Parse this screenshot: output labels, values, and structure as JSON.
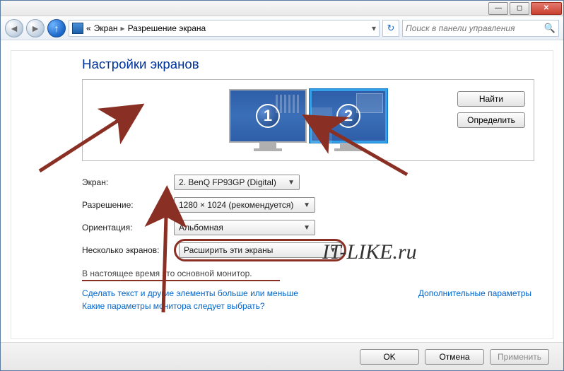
{
  "window_controls": {
    "minimize_glyph": "—",
    "maximize_glyph": "◻",
    "close_glyph": "✕"
  },
  "nav": {
    "back_glyph": "◄",
    "forward_glyph": "►",
    "up_glyph": "↑",
    "prefix": "«",
    "crumb1": "Экран",
    "sep": "▸",
    "crumb2": "Разрешение экрана",
    "drop_glyph": "▾",
    "refresh_glyph": "↻",
    "search_placeholder": "Поиск в панели управления",
    "search_icon": "🔍"
  },
  "heading": "Настройки экранов",
  "monitors": {
    "num1": "1",
    "num2": "2"
  },
  "buttons": {
    "find": "Найти",
    "detect": "Определить"
  },
  "form": {
    "screen_label": "Экран:",
    "screen_value": "2. BenQ FP93GP (Digital)",
    "resolution_label": "Разрешение:",
    "resolution_value": "1280 × 1024 (рекомендуется)",
    "orientation_label": "Ориентация:",
    "orientation_value": "Альбомная",
    "multi_label": "Несколько экранов:",
    "multi_value": "Расширить эти экраны",
    "arrow": "▼"
  },
  "note": "В настоящее время это основной монитор.",
  "links": {
    "advanced": "Дополнительные параметры",
    "bigger": "Сделать текст и другие элементы больше или меньше",
    "which": "Какие параметры монитора следует выбрать?"
  },
  "footer": {
    "ok": "OK",
    "cancel": "Отмена",
    "apply": "Применить"
  },
  "watermark": "IT-LIKE.ru",
  "annotation_color": "#8a2f23"
}
